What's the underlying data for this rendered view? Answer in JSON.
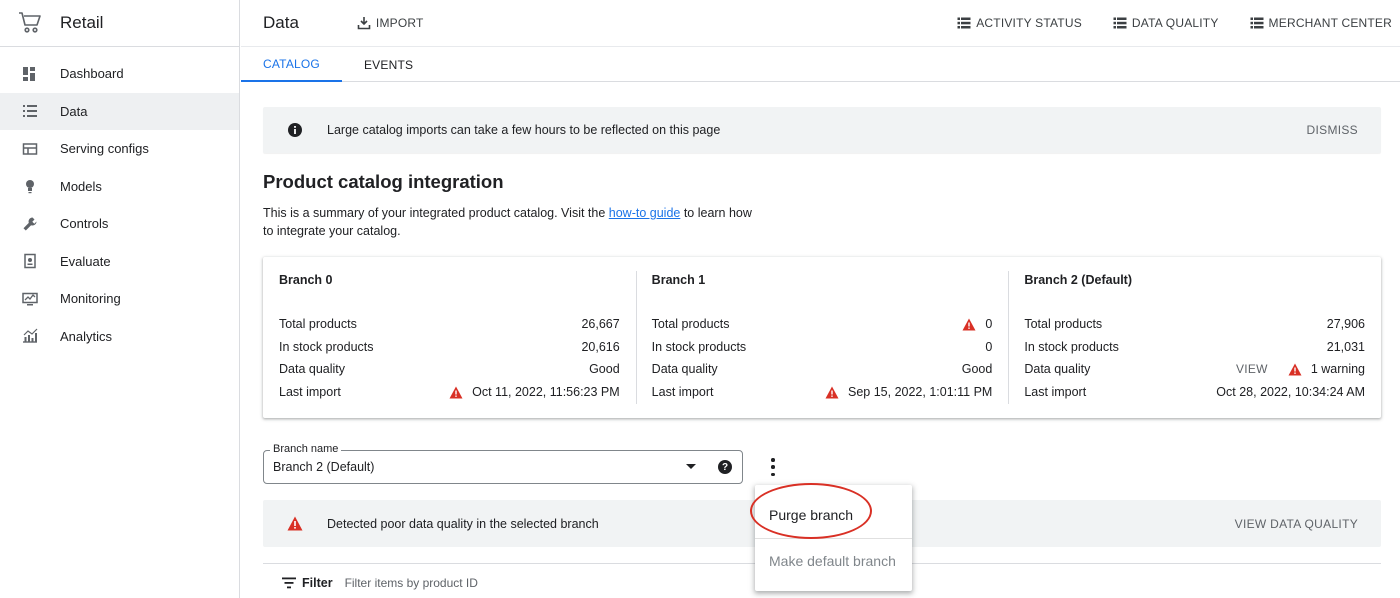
{
  "app": {
    "title": "Retail"
  },
  "sidebar": {
    "items": [
      {
        "label": "Dashboard",
        "icon": "dashboard-icon"
      },
      {
        "label": "Data",
        "icon": "list-icon",
        "active": true
      },
      {
        "label": "Serving configs",
        "icon": "serving-configs-icon"
      },
      {
        "label": "Models",
        "icon": "lightbulb-icon"
      },
      {
        "label": "Controls",
        "icon": "wrench-icon"
      },
      {
        "label": "Evaluate",
        "icon": "evaluate-icon"
      },
      {
        "label": "Monitoring",
        "icon": "monitoring-icon"
      },
      {
        "label": "Analytics",
        "icon": "analytics-icon"
      }
    ]
  },
  "header": {
    "title": "Data",
    "import_label": "IMPORT",
    "activity_status_label": "ACTIVITY STATUS",
    "data_quality_label": "DATA QUALITY",
    "merchant_center_label": "MERCHANT CENTER"
  },
  "tabs": [
    {
      "label": "CATALOG",
      "active": true
    },
    {
      "label": "EVENTS"
    }
  ],
  "info_banner": {
    "text": "Large catalog imports can take a few hours to be reflected on this page",
    "action": "DISMISS"
  },
  "section": {
    "title": "Product catalog integration",
    "desc_before": "This is a summary of your integrated product catalog. Visit the ",
    "desc_link": "how-to guide",
    "desc_after": " to learn how to integrate your catalog."
  },
  "branches": [
    {
      "title": "Branch 0",
      "rows": [
        {
          "label": "Total products",
          "value": "26,667"
        },
        {
          "label": "In stock products",
          "value": "20,616"
        },
        {
          "label": "Data quality",
          "value": "Good"
        },
        {
          "label": "Last import",
          "value": "Oct 11, 2022, 11:56:23 PM",
          "warning": true
        }
      ]
    },
    {
      "title": "Branch 1",
      "rows": [
        {
          "label": "Total products",
          "value": "0",
          "warning": true
        },
        {
          "label": "In stock products",
          "value": "0"
        },
        {
          "label": "Data quality",
          "value": "Good"
        },
        {
          "label": "Last import",
          "value": "Sep 15, 2022, 1:01:11 PM",
          "warning": true
        }
      ]
    },
    {
      "title": "Branch 2 (Default)",
      "rows": [
        {
          "label": "Total products",
          "value": "27,906"
        },
        {
          "label": "In stock products",
          "value": "21,031"
        },
        {
          "label": "Data quality",
          "value": "1 warning",
          "warning": true,
          "view": "VIEW"
        },
        {
          "label": "Last import",
          "value": "Oct 28, 2022, 10:34:24 AM"
        }
      ]
    }
  ],
  "branch_select": {
    "label": "Branch name",
    "value": "Branch 2 (Default)",
    "help": "?"
  },
  "warning_banner": {
    "text": "Detected poor data quality in the selected branch",
    "action": "VIEW DATA QUALITY"
  },
  "filter": {
    "label": "Filter",
    "placeholder": "Filter items by product ID"
  },
  "context_menu": {
    "items": [
      {
        "label": "Purge branch"
      },
      {
        "label": "Make default branch",
        "disabled": true
      }
    ]
  },
  "colors": {
    "accent": "#1a73e8",
    "warning": "#d93025",
    "highlight": "#d93025",
    "banner_bg": "#f1f3f4"
  }
}
